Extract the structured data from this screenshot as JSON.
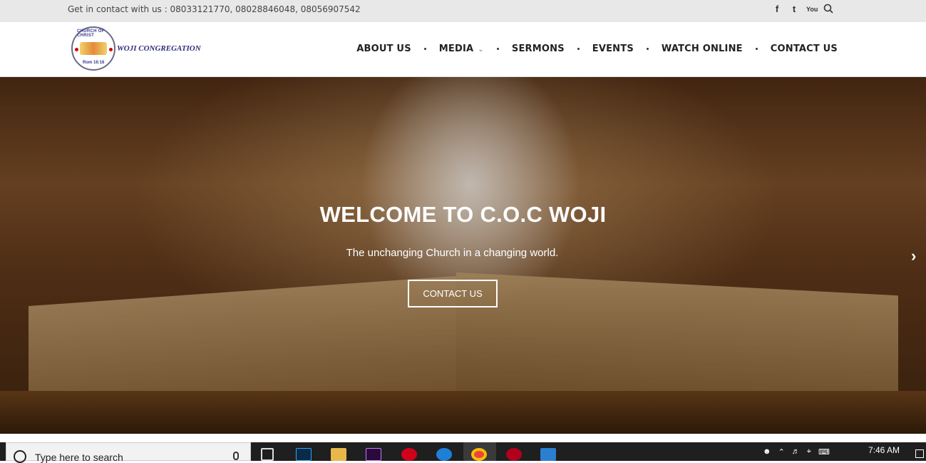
{
  "topbar": {
    "contact_text": "Get in contact with us : 08033121770, 08028846048, 08056907542",
    "social": [
      "facebook-icon",
      "twitter-icon",
      "youtube-icon",
      "search-icon"
    ]
  },
  "logo": {
    "ring_top": "CHURCH OF CHRIST",
    "ring_bottom": "Rom 16:16",
    "text": "WOJI CONGREGATION"
  },
  "nav": {
    "about": "ABOUT US",
    "media": "MEDIA",
    "sermons": "SERMONS",
    "events": "EVENTS",
    "watch": "WATCH ONLINE",
    "contact": "CONTACT US"
  },
  "hero": {
    "title": "WELCOME TO C.O.C WOJI",
    "subtitle": "The unchanging Church in a changing world.",
    "cta": "CONTACT US"
  },
  "taskbar": {
    "search_placeholder": "Type here to search",
    "time": "7:46 AM"
  }
}
